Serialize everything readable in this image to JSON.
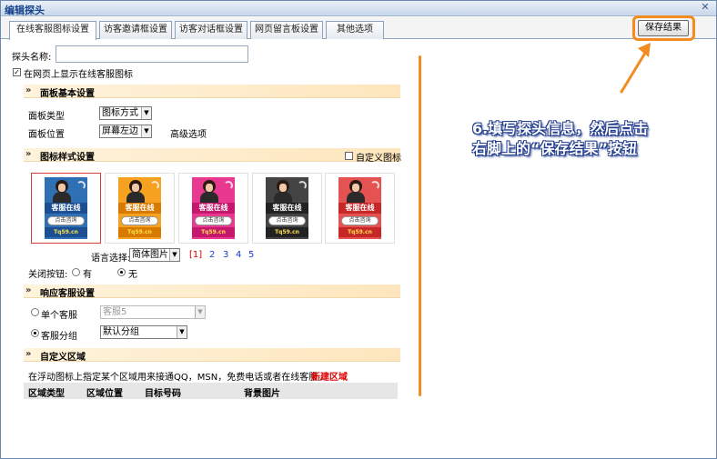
{
  "window": {
    "title": "编辑探头",
    "close_glyph": "✕"
  },
  "tabs": [
    {
      "label": "在线客服图标设置",
      "active": true
    },
    {
      "label": "访客邀请框设置",
      "active": false
    },
    {
      "label": "访客对话框设置",
      "active": false
    },
    {
      "label": "网页留言板设置",
      "active": false
    },
    {
      "label": "其他选项",
      "active": false
    }
  ],
  "toolbar": {
    "save_label": "保存结果"
  },
  "probe": {
    "name_label": "探头名称:",
    "name_value": "",
    "show_on_page_label": "在网页上显示在线客服图标",
    "show_on_page_checked": true
  },
  "panel_basic": {
    "title": "面板基本设置",
    "type_label": "面板类型",
    "type_value": "图标方式",
    "position_label": "面板位置",
    "position_value": "屏幕左边",
    "advanced_label": "高级选项"
  },
  "icon_style": {
    "title": "图标样式设置",
    "custom_icon_label": "自定义图标",
    "custom_icon_checked": false,
    "cards": [
      {
        "banner": "客服在线",
        "button": "点击咨询",
        "foot": "Tq59.cn",
        "accent": "#2f6fb3",
        "banner_color": "#1b4f91",
        "selected": true
      },
      {
        "banner": "客服在线",
        "button": "点击咨询",
        "foot": "Tq59.cn",
        "accent": "#f6a11f",
        "banner_color": "#d97a00",
        "selected": false
      },
      {
        "banner": "客服在线",
        "button": "点击咨询",
        "foot": "Tq59.cn",
        "accent": "#e9388f",
        "banner_color": "#c4176d",
        "selected": false
      },
      {
        "banner": "客服在线",
        "button": "点击咨询",
        "foot": "Tq59.cn",
        "accent": "#444444",
        "banner_color": "#222222",
        "selected": false
      },
      {
        "banner": "客服在线",
        "button": "点击咨询",
        "foot": "Tq59.cn",
        "accent": "#e55252",
        "banner_color": "#c62828",
        "selected": false
      }
    ],
    "language_label": "语言选择:",
    "language_value": "简体图片",
    "pages": [
      "[1]",
      "2",
      "3",
      "4",
      "5"
    ],
    "close_button_label": "关闭按钮:",
    "close_yes_label": "有",
    "close_no_label": "无",
    "close_selected": "无"
  },
  "response_service": {
    "title": "响应客服设置",
    "single_label": "单个客服",
    "single_value": "客服5",
    "group_label": "客服分组",
    "group_value": "默认分组",
    "selected": "客服分组"
  },
  "custom_area": {
    "title": "自定义区域",
    "description": "在浮动图标上指定某个区域用来接通QQ，MSN，免费电话或者在线客服。",
    "new_area_link": "新建区域",
    "columns": [
      "区域类型",
      "区域位置",
      "目标号码",
      "背景图片"
    ]
  },
  "annotation": {
    "line1": "6.填写探头信息，然后点击",
    "line2": "右脚上的“保存结果”按钮"
  },
  "colors": {
    "accent": "#f28c21",
    "annotation_text": "#ffffff",
    "annotation_stroke": "#1f3a8c",
    "link_red": "#e00000",
    "page_blue": "#1a3fd0"
  }
}
